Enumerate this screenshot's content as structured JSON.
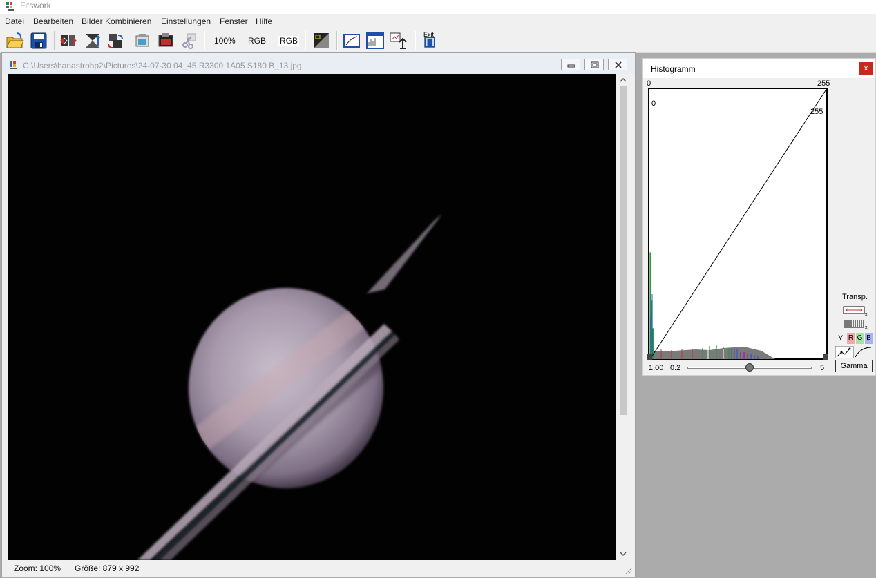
{
  "app": {
    "title": "Fitswork",
    "accent": "#1e78c8"
  },
  "menu": [
    "Datei",
    "Bearbeiten",
    "Bilder Kombinieren",
    "Einstellungen",
    "Fenster",
    "Hilfe"
  ],
  "toolbar": {
    "icons": [
      "open-folder-icon",
      "save-disk-icon",
      "flip-horizontal-icon",
      "flip-vertical-icon",
      "rotate-icon",
      "copy-image-icon",
      "paste-image-icon",
      "cut-image-icon",
      "mask-icon",
      "crop-icon",
      "histogram-icon",
      "stars-icon",
      "exit-icon"
    ],
    "zoom_label": "100%",
    "rgb_label_1": "RGB",
    "rgb_label_2": "RGB",
    "exit_label": "Exit"
  },
  "image_window": {
    "title": "C:\\Users\\hanastrohp2\\Pictures\\24-07-30 04_45 R3300 1A05 S180 B_13.jpg",
    "status_zoom": "Zoom: 100%",
    "status_size": "Größe: 879 x 992"
  },
  "histogram": {
    "title": "Histogramm",
    "close_label": "x",
    "axis_top_left": "0",
    "axis_top_right": "255",
    "curve_label_left": "0",
    "curve_label_right": "255",
    "transp_label": "Transp.",
    "channel_y": "Y",
    "channel_r": "R",
    "channel_g": "G",
    "channel_b": "B",
    "gamma_value": "1.00",
    "gamma_min": "0.2",
    "gamma_max": "5",
    "gamma_button": "Gamma",
    "gamma_slider_fraction": 0.5
  }
}
